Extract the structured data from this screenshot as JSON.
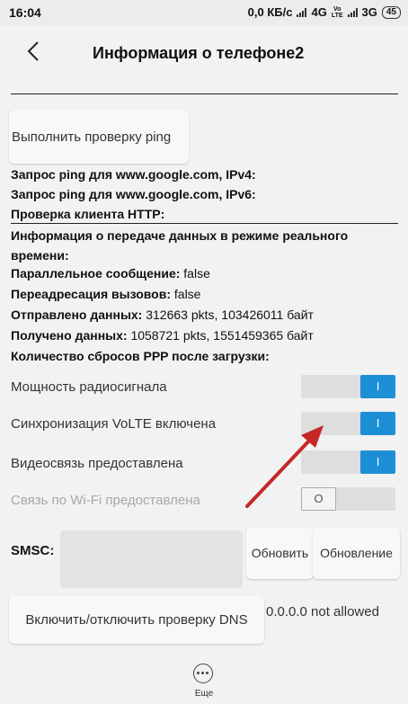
{
  "status_bar": {
    "time": "16:04",
    "speed": "0,0 КБ/с",
    "net1": "4G",
    "volte1": "Vo",
    "volte2": "LTE",
    "net2": "3G",
    "battery": "45"
  },
  "header": {
    "title": "Информация о телефоне2"
  },
  "ping_button": "Выполнить проверку ping",
  "info": {
    "ping_ipv4": "Запрос ping для www.google.com, IPv4:",
    "ping_ipv6": "Запрос ping для www.google.com, IPv6:",
    "http_check": "Проверка клиента HTTP:",
    "realtime_label": "Информация о передаче данных в режиме реального времени:",
    "parallel_label": "Параллельное сообщение:",
    "parallel_value": " false",
    "forward_label": "Переадресация вызовов:",
    "forward_value": " false",
    "sent_label": "Отправлено данных:",
    "sent_value": " 312663 pkts, 103426011 байт",
    "received_label": "Получено данных:",
    "received_value": " 1058721 pkts, 1551459365 байт",
    "ppp_label": "Количество сбросов PPP после загрузки:"
  },
  "toggles": [
    {
      "label": "Мощность радиосигнала",
      "state": "I"
    },
    {
      "label": "Синхронизация VoLTE включена",
      "state": "I"
    },
    {
      "label": "Видеосвязь предоставлена",
      "state": "I"
    },
    {
      "label": "Связь по Wi-Fi предоставлена",
      "state": "O"
    }
  ],
  "smsc": {
    "label": "SMSC:",
    "update_button": "Обновить",
    "refresh_button": "Обновление"
  },
  "dns": {
    "button": "Включить/отключить проверку DNS",
    "status": "0.0.0.0 not allowed"
  },
  "more": {
    "label": "Еще"
  },
  "colors": {
    "accent": "#1d8fd6",
    "arrow": "#c62828"
  }
}
